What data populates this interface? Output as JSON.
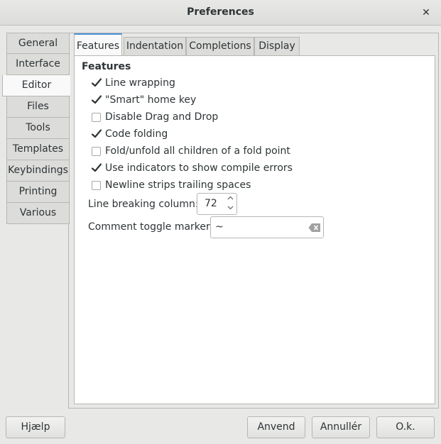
{
  "window": {
    "title": "Preferences",
    "close_glyph": "✕"
  },
  "sidebar": {
    "tabs": [
      {
        "label": "General"
      },
      {
        "label": "Interface"
      },
      {
        "label": "Editor",
        "active": true
      },
      {
        "label": "Files"
      },
      {
        "label": "Tools"
      },
      {
        "label": "Templates"
      },
      {
        "label": "Keybindings"
      },
      {
        "label": "Printing"
      },
      {
        "label": "Various"
      }
    ]
  },
  "editor": {
    "tabs": [
      {
        "label": "Features",
        "active": true
      },
      {
        "label": "Indentation"
      },
      {
        "label": "Completions"
      },
      {
        "label": "Display"
      }
    ],
    "features": {
      "heading": "Features",
      "options": [
        {
          "label": "Line wrapping",
          "checked": true
        },
        {
          "label": "\"Smart\" home key",
          "checked": true
        },
        {
          "label": "Disable Drag and Drop",
          "checked": false
        },
        {
          "label": "Code folding",
          "checked": true
        },
        {
          "label": "Fold/unfold all children of a fold point",
          "checked": false
        },
        {
          "label": "Use indicators to show compile errors",
          "checked": true
        },
        {
          "label": "Newline strips trailing spaces",
          "checked": false
        }
      ],
      "line_breaking": {
        "label": "Line breaking column:",
        "value": "72"
      },
      "comment_toggle": {
        "label": "Comment toggle marker:",
        "value": "~"
      }
    }
  },
  "buttons": {
    "help": "Hjælp",
    "apply": "Anvend",
    "cancel": "Annullér",
    "ok": "O.k."
  },
  "colors": {
    "accent": "#4a90d9",
    "background": "#e8e8e7"
  }
}
